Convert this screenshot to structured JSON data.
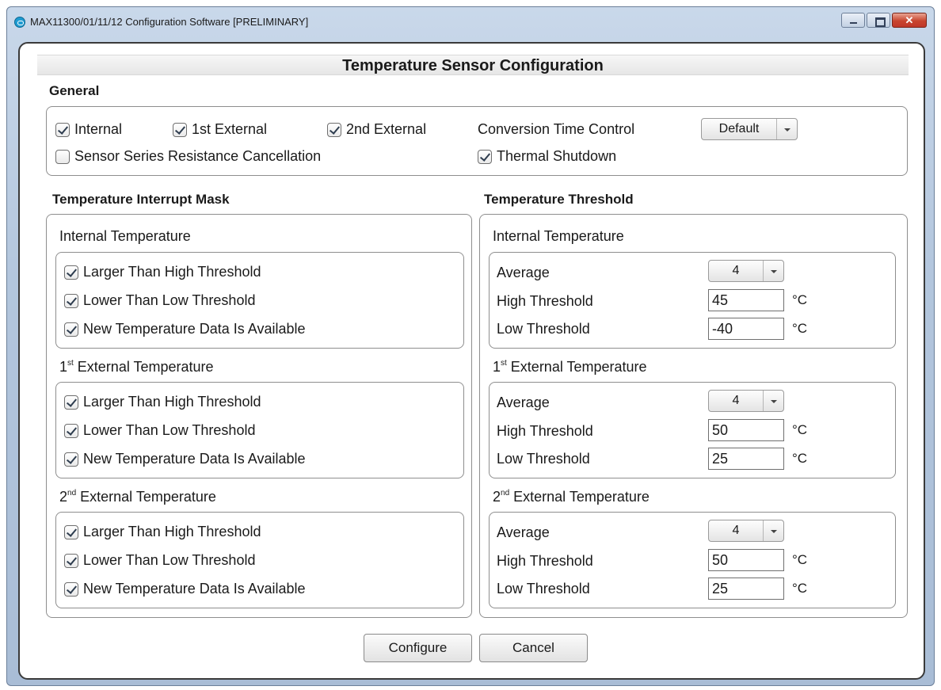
{
  "window": {
    "title": "MAX11300/01/11/12 Configuration Software [PRELIMINARY]"
  },
  "dialog": {
    "title": "Temperature Sensor Configuration"
  },
  "general": {
    "heading": "General",
    "internal": {
      "label": "Internal",
      "checked": true
    },
    "ext1": {
      "label": "1st External",
      "checked": true
    },
    "ext2": {
      "label": "2nd External",
      "checked": true
    },
    "conversion_label": "Conversion Time Control",
    "conversion_value": "Default",
    "series_resistance": {
      "label": "Sensor Series Resistance Cancellation",
      "checked": false
    },
    "thermal_shutdown": {
      "label": "Thermal Shutdown",
      "checked": true
    }
  },
  "interrupt_mask": {
    "heading": "Temperature Interrupt Mask",
    "groups": [
      {
        "title_prefix": "Internal Temperature",
        "title_sup": "",
        "title_suffix": "",
        "items": [
          {
            "label": "Larger Than High Threshold",
            "checked": true
          },
          {
            "label": "Lower Than Low Threshold",
            "checked": true
          },
          {
            "label": "New Temperature Data Is Available",
            "checked": true
          }
        ]
      },
      {
        "title_prefix": "1",
        "title_sup": "st",
        "title_suffix": " External Temperature",
        "items": [
          {
            "label": "Larger Than High Threshold",
            "checked": true
          },
          {
            "label": "Lower Than Low Threshold",
            "checked": true
          },
          {
            "label": "New Temperature Data Is Available",
            "checked": true
          }
        ]
      },
      {
        "title_prefix": "2",
        "title_sup": "nd",
        "title_suffix": " External Temperature",
        "items": [
          {
            "label": "Larger Than High Threshold",
            "checked": true
          },
          {
            "label": "Lower Than Low Threshold",
            "checked": true
          },
          {
            "label": "New Temperature Data Is Available",
            "checked": true
          }
        ]
      }
    ]
  },
  "threshold": {
    "heading": "Temperature Threshold",
    "average_label": "Average",
    "high_label": "High Threshold",
    "low_label": "Low Threshold",
    "unit": "°C",
    "groups": [
      {
        "title_prefix": "Internal Temperature",
        "title_sup": "",
        "title_suffix": "",
        "average": "4",
        "high": "45",
        "low": "-40"
      },
      {
        "title_prefix": "1",
        "title_sup": "st",
        "title_suffix": " External Temperature",
        "average": "4",
        "high": "50",
        "low": "25"
      },
      {
        "title_prefix": "2",
        "title_sup": "nd",
        "title_suffix": " External Temperature",
        "average": "4",
        "high": "50",
        "low": "25"
      }
    ]
  },
  "buttons": {
    "configure": "Configure",
    "cancel": "Cancel"
  }
}
